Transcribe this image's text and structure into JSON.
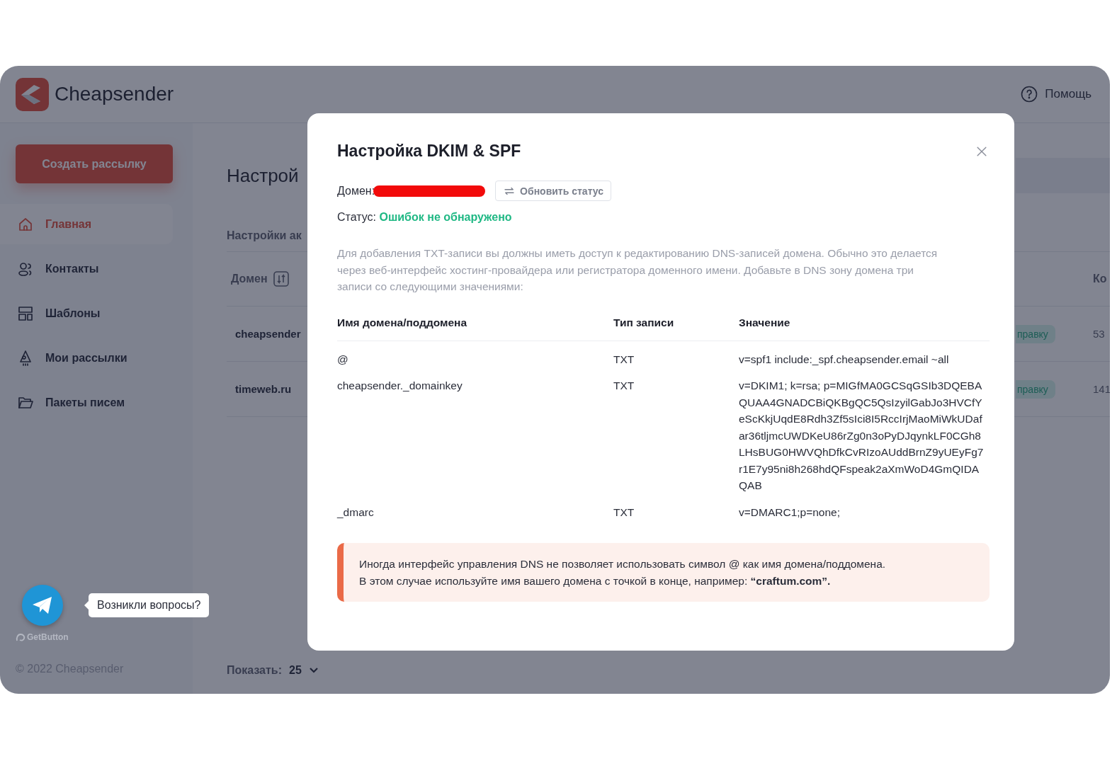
{
  "header": {
    "brand": "Cheapsender",
    "help": "Помощь"
  },
  "sidebar": {
    "create_button": "Создать рассылку",
    "items": [
      {
        "label": "Главная",
        "selected": true
      },
      {
        "label": "Контакты",
        "selected": false
      },
      {
        "label": "Шаблоны",
        "selected": false
      },
      {
        "label": "Мои рассылки",
        "selected": false
      },
      {
        "label": "Пакеты писем",
        "selected": false
      }
    ],
    "copyright": "© 2022 Cheapsender"
  },
  "chat_widget": {
    "bubble": "Возникли вопросы?",
    "credit": "GetButton"
  },
  "main": {
    "title": "Настрой",
    "tab": "Настройки ак",
    "columns": [
      "Домен",
      "Ко"
    ],
    "rows": [
      {
        "domain": "cheapsender",
        "badge": "правку",
        "count": "53"
      },
      {
        "domain": "timeweb.ru",
        "badge": "правку",
        "count": "141"
      }
    ],
    "pager": {
      "label": "Показать:",
      "value": "25"
    }
  },
  "modal": {
    "title": "Настройка DKIM & SPF",
    "domain_label": "Домен:",
    "refresh_button": "Обновить статус",
    "status_label": "Статус:",
    "status_value": "Ошибок не обнаружено",
    "description": "Для добавления TXT-записи вы должны иметь доступ к редактированию DNS-записей домена. Обычно это делается через веб-интерфейс хостинг-провайдера или регистратора доменного имени. Добавьте в DNS зону домена три записи со следующими значениями:",
    "table": {
      "columns": [
        "Имя домена/поддомена",
        "Тип записи",
        "Значение"
      ],
      "rows": [
        [
          "@",
          "TXT",
          "v=spf1 include:_spf.cheapsender.email ~all"
        ],
        [
          "cheapsender._domainkey",
          "TXT",
          "v=DKIM1; k=rsa; p=MIGfMA0GCSqGSIb3DQEBAQUAA4GNADCBiQKBgQC5QsIzyilGabJo3HVCfYeScKkjUqdE8Rdh3Zf5sIci8I5RccIrjMaoMiWkUDafar36tljmcUWDKeU86rZg0n3oPyDJqynkLF0CGh8LHsBUG0HWVQhDfkCvRIzoAUddBrnZ9yUEyFg7r1E7y95ni8h268hdQFspeak2aXmWoD4GmQIDAQAB"
        ],
        [
          "_dmarc",
          "TXT",
          "v=DMARC1;p=none;"
        ]
      ]
    },
    "note": [
      "Иногда интерфейс управления DNS не позволяет использовать символ @ как имя домена/поддомена.",
      "В этом случае используйте имя вашего домена с точкой в конце, например: **“craftum.com”.**"
    ]
  }
}
